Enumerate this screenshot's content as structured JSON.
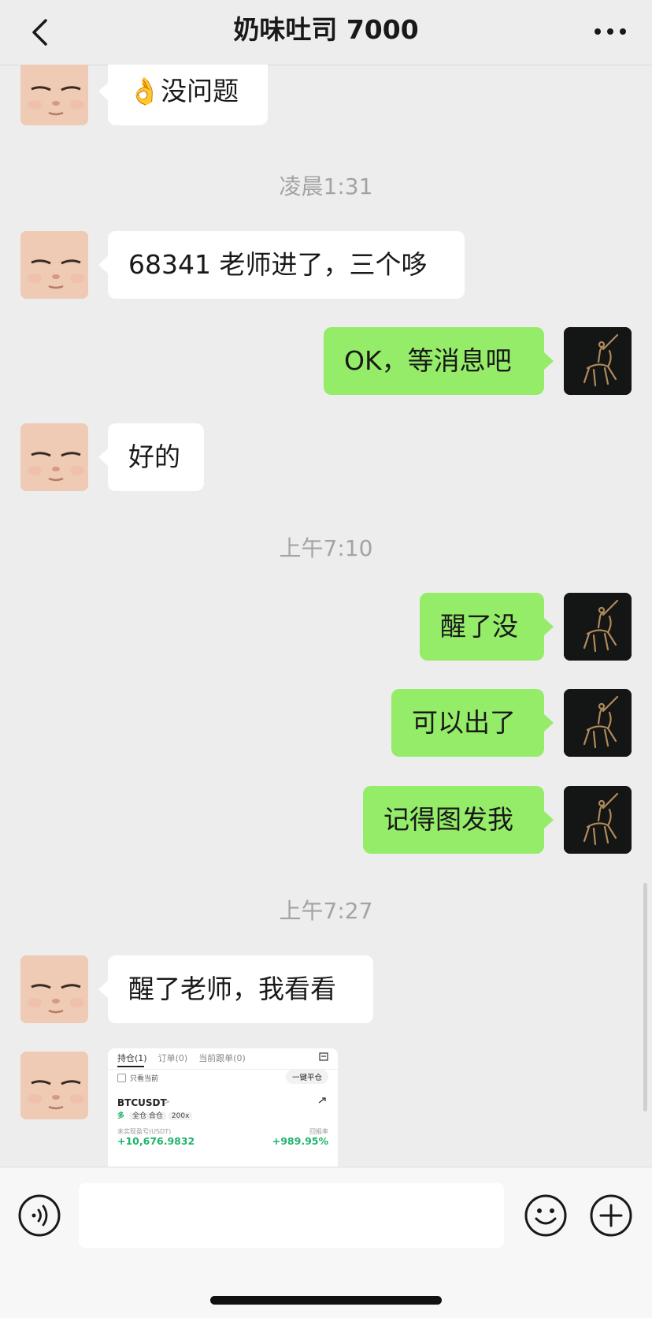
{
  "header": {
    "title": "奶味吐司 7000"
  },
  "messages": {
    "m0": "👌没问题",
    "t1": "凌晨1:31",
    "m1": "68341 老师进了，三个哆",
    "m2": "OK，等消息吧",
    "m3": "好的",
    "t2": "上午7:10",
    "m4": "醒了没",
    "m5": "可以出了",
    "m6": "记得图发我",
    "t3": "上午7:27",
    "m7": "醒了老师，我看看"
  },
  "screenshot": {
    "tab_positions": "持仓(1)",
    "tab_orders": "订单(0)",
    "tab_copy": "当前跟单(0)",
    "only_current": "只看当前",
    "close_all": "一键平仓",
    "symbol": "BTCUSDT",
    "symbol_arrow": ">",
    "side": "多",
    "margin_mode": "全仓 合仓",
    "leverage": "200x",
    "unrealized_label": "未实现盈亏(USDT)",
    "unrealized_value": "+10,676.9832",
    "roe_label": "回报率",
    "roe_value": "+989.95%"
  },
  "colors": {
    "background": "#ededed",
    "outgoing_bubble": "#95ec69",
    "incoming_bubble": "#ffffff",
    "profit_green": "#1fb36b"
  },
  "icons": {
    "back": "chevron-left-icon",
    "more": "more-dots-icon",
    "voice": "voice-icon",
    "emoji": "emoji-icon",
    "plus": "plus-icon"
  }
}
